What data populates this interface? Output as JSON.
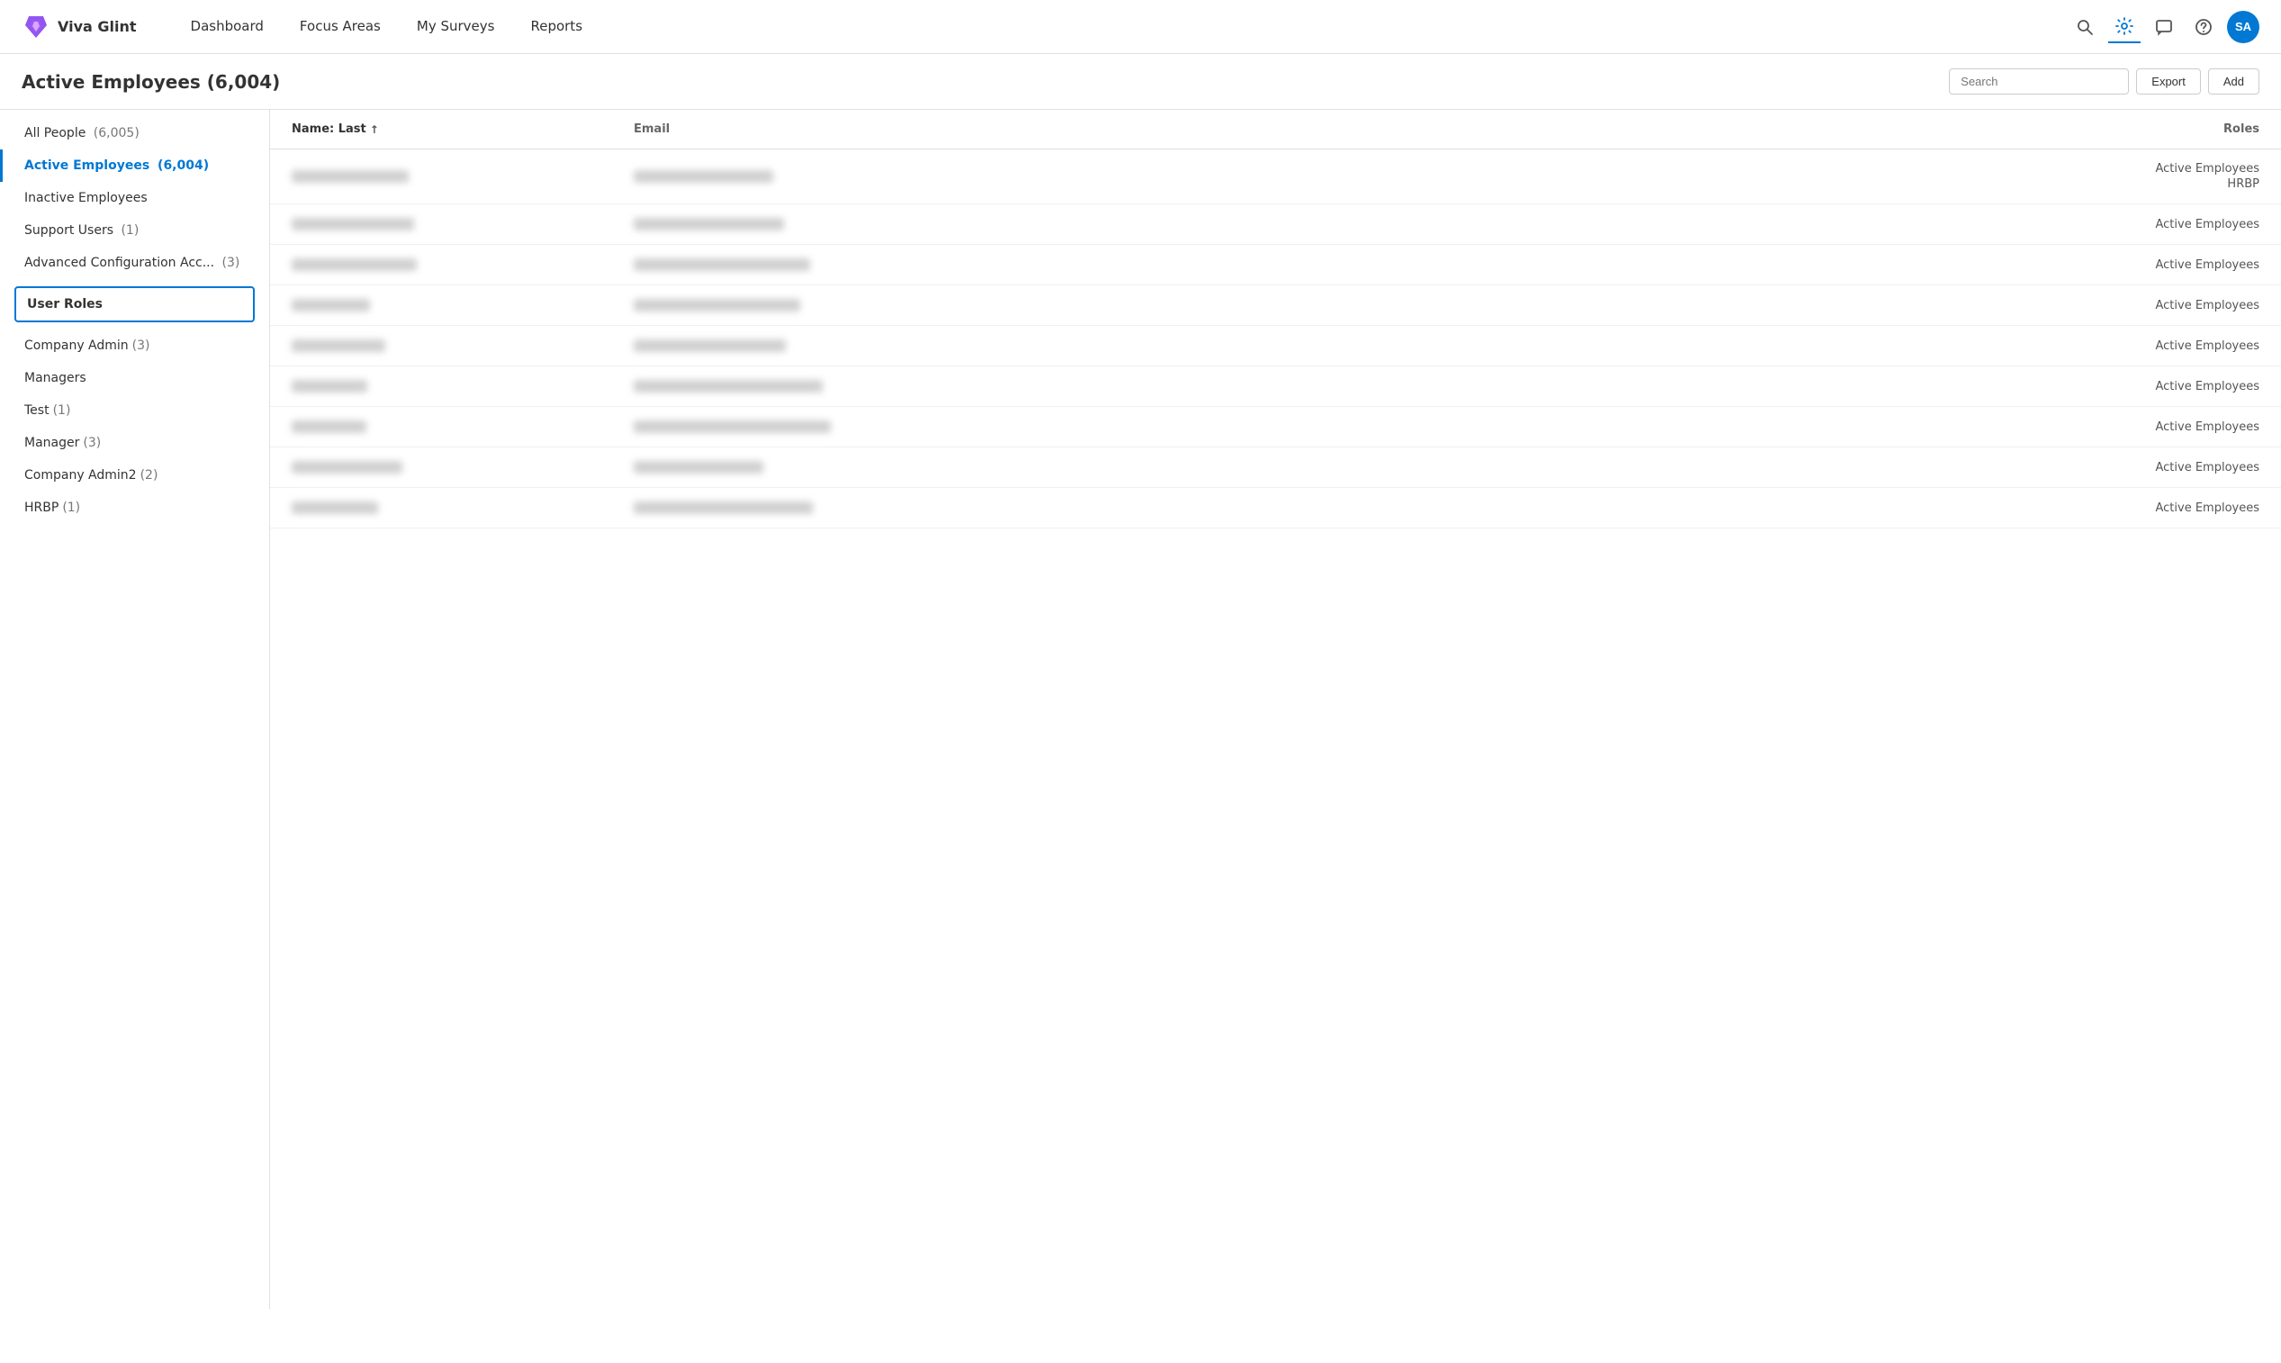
{
  "navbar": {
    "logo_text": "Viva Glint",
    "nav_items": [
      {
        "id": "dashboard",
        "label": "Dashboard",
        "active": false
      },
      {
        "id": "focus-areas",
        "label": "Focus Areas",
        "active": false
      },
      {
        "id": "my-surveys",
        "label": "My Surveys",
        "active": false
      },
      {
        "id": "reports",
        "label": "Reports",
        "active": false
      }
    ],
    "avatar_initials": "SA"
  },
  "page": {
    "title": "Active Employees (6,004)",
    "search_placeholder": "Search",
    "export_label": "Export",
    "add_label": "Add"
  },
  "sidebar": {
    "all_people_label": "All People",
    "all_people_count": "(6,005)",
    "active_employees_label": "Active Employees",
    "active_employees_count": "(6,004)",
    "inactive_employees_label": "Inactive Employees",
    "support_users_label": "Support Users",
    "support_users_count": "(1)",
    "advanced_config_label": "Advanced Configuration Acc...",
    "advanced_config_count": "(3)",
    "user_roles_label": "User Roles",
    "role_items": [
      {
        "label": "Company Admin",
        "count": "(3)"
      },
      {
        "label": "Managers",
        "count": ""
      },
      {
        "label": "Test",
        "count": "(1)"
      },
      {
        "label": "Manager",
        "count": "(3)"
      },
      {
        "label": "Company Admin2",
        "count": "(2)"
      },
      {
        "label": "HRBP",
        "count": "(1)"
      }
    ]
  },
  "table": {
    "col_name": "Name: Last",
    "col_email": "Email",
    "col_roles": "Roles",
    "rows": [
      {
        "name": "████████ ████",
        "email": "████████████████████████████",
        "roles": [
          "Active Employees",
          "HRBP"
        ]
      },
      {
        "name": "████ ████",
        "email": "████████████████████████",
        "roles": [
          "Active Employees"
        ]
      },
      {
        "name": "████████ ████",
        "email": "████████████████████████████",
        "roles": [
          "Active Employees"
        ]
      },
      {
        "name": "████████ ████",
        "email": "████████████████████████████",
        "roles": [
          "Active Employees"
        ]
      },
      {
        "name": "██████ ████",
        "email": "████████████████████████████",
        "roles": [
          "Active Employees"
        ]
      },
      {
        "name": "███ ████",
        "email": "████████████████████████████",
        "roles": [
          "Active Employees"
        ]
      },
      {
        "name": "████ ████",
        "email": "████████████████████████████",
        "roles": [
          "Active Employees"
        ]
      },
      {
        "name": "████████ ████",
        "email": "████████████████████████████",
        "roles": [
          "Active Employees"
        ]
      },
      {
        "name": "███████ ████████",
        "email": "████████████████████████████",
        "roles": [
          "Active Employees"
        ]
      }
    ]
  }
}
